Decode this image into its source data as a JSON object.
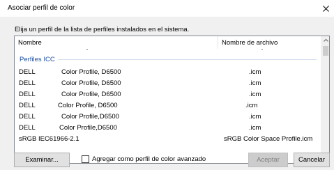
{
  "window": {
    "title": "Asociar perfil de color"
  },
  "instruction": "Elija un perfil de la lista de perfiles instalados en el sistema.",
  "columns": {
    "name": "Nombre",
    "file": "Nombre de archivo"
  },
  "group": {
    "label": "Perfiles ICC"
  },
  "rows": [
    {
      "prefix": "DELL",
      "name": "Color Profile, D6500",
      "file": ".icm"
    },
    {
      "prefix": "DELL",
      "name": "Color Profile, D6500",
      "file": ".icm"
    },
    {
      "prefix": "DELL",
      "name": "Color Profile, D6500",
      "file": ".icm"
    },
    {
      "prefix": "DELL",
      "name": "Color Profile, D6500",
      "file": ".icm"
    },
    {
      "prefix": "DELL",
      "name": "Color Profile,D6500",
      "file": ".icm"
    },
    {
      "prefix": "DELL",
      "name": "Color Profile,D6500",
      "file": ".icm"
    },
    {
      "prefix": "sRGB IEC61966-2.1",
      "name": "",
      "file": "sRGB Color Space Profile.icm"
    }
  ],
  "buttons": {
    "browse": "Examinar...",
    "accept": "Aceptar",
    "cancel": "Cancelar"
  },
  "advanced_checkbox": {
    "label": "Agregar como perfil de color avanzado",
    "checked": false
  }
}
